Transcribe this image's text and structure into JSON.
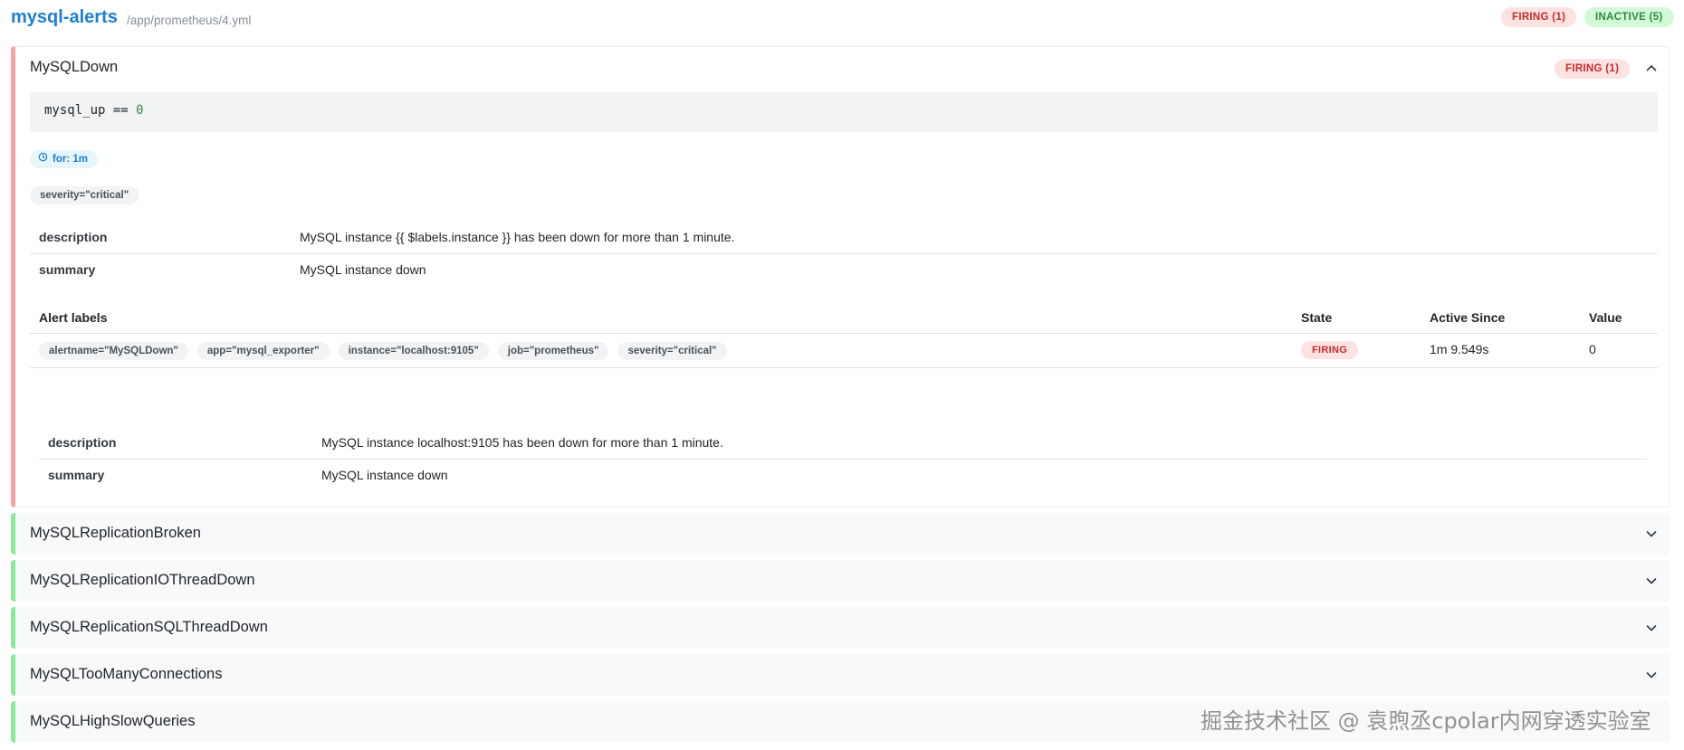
{
  "group": {
    "title": "mysql-alerts",
    "file": "/app/prometheus/4.yml",
    "firing_badge": "FIRING (1)",
    "inactive_badge": "INACTIVE (5)"
  },
  "open_rule": {
    "name": "MySQLDown",
    "state_badge": "FIRING (1)",
    "expr_left": "mysql_up == ",
    "expr_value": "0",
    "for_text": "for: 1m",
    "labels": [
      "severity=\"critical\""
    ],
    "annotations": [
      {
        "key": "description",
        "value": "MySQL instance {{ $labels.instance }} has been down for more than 1 minute."
      },
      {
        "key": "summary",
        "value": "MySQL instance down"
      }
    ],
    "alerts_table": {
      "headers": {
        "labels": "Alert labels",
        "state": "State",
        "active_since": "Active Since",
        "value": "Value"
      },
      "rows": [
        {
          "labels": [
            "alertname=\"MySQLDown\"",
            "app=\"mysql_exporter\"",
            "instance=\"localhost:9105\"",
            "job=\"prometheus\"",
            "severity=\"critical\""
          ],
          "state": "FIRING",
          "active_since": "1m 9.549s",
          "value": "0",
          "annotations": [
            {
              "key": "description",
              "value": "MySQL instance localhost:9105 has been down for more than 1 minute."
            },
            {
              "key": "summary",
              "value": "MySQL instance down"
            }
          ]
        }
      ]
    }
  },
  "collapsed_rules": [
    {
      "name": "MySQLReplicationBroken"
    },
    {
      "name": "MySQLReplicationIOThreadDown"
    },
    {
      "name": "MySQLReplicationSQLThreadDown"
    },
    {
      "name": "MySQLTooManyConnections"
    },
    {
      "name": "MySQLHighSlowQueries"
    }
  ],
  "watermark": "掘金技术社区 @ 袁煦丞cpolar内网穿透实验室",
  "colors": {
    "firing": "#c92a2a",
    "inactive": "#2b8a3e",
    "link": "#1c7ed6"
  },
  "icons": {
    "collapse": "chevron-up-icon",
    "expand": "chevron-down-icon",
    "duration": "clock-icon"
  }
}
